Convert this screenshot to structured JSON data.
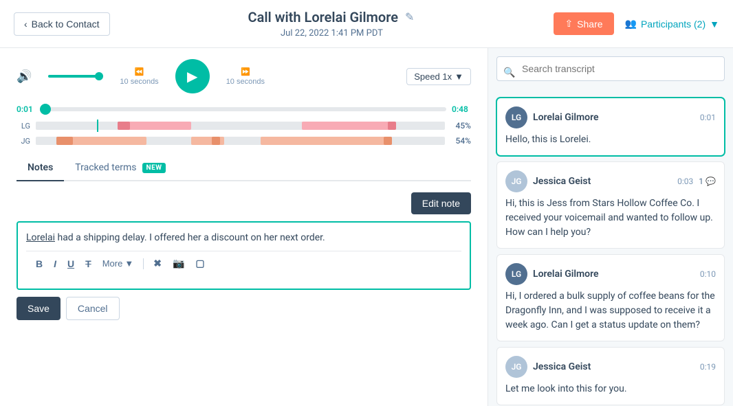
{
  "header": {
    "back_label": "Back to Contact",
    "call_title": "Call with Lorelai Gilmore",
    "call_date": "Jul 22, 2022 1:41 PM PDT",
    "share_label": "Share",
    "participants_label": "Participants (2)"
  },
  "audio": {
    "rewind_label": "10 seconds",
    "forward_label": "10 seconds",
    "speed_label": "Speed 1x",
    "time_start": "0:01",
    "time_end": "0:48"
  },
  "speakers": [
    {
      "id": "LG",
      "pct": "45%"
    },
    {
      "id": "JG",
      "pct": "54%"
    }
  ],
  "tabs": [
    {
      "id": "notes",
      "label": "Notes",
      "active": true
    },
    {
      "id": "tracked",
      "label": "Tracked terms",
      "badge": "NEW"
    }
  ],
  "note": {
    "edit_label": "Edit note",
    "content": "Lorelai had a shipping delay. I offered her a discount on her next order.",
    "toolbar": {
      "bold": "B",
      "italic": "I",
      "underline": "U",
      "strikethrough": "T",
      "more_label": "More"
    },
    "save_label": "Save",
    "cancel_label": "Cancel"
  },
  "transcript": {
    "search_placeholder": "Search transcript",
    "entries": [
      {
        "name": "Lorelai Gilmore",
        "initials": "LG",
        "time": "0:01",
        "text": "Hello, this is Lorelei.",
        "active": true,
        "comment_count": null
      },
      {
        "name": "Jessica Geist",
        "initials": "JG",
        "time": "0:03",
        "text": "Hi, this is Jess from Stars Hollow Coffee Co. I received your voicemail and wanted to follow up. How can I help you?",
        "active": false,
        "comment_count": 1
      },
      {
        "name": "Lorelai Gilmore",
        "initials": "LG",
        "time": "0:10",
        "text": "Hi, I ordered a bulk supply of coffee beans for the Dragonfly Inn, and I was supposed to receive it a week ago. Can I get a status update on them?",
        "active": false,
        "comment_count": null
      },
      {
        "name": "Jessica Geist",
        "initials": "JG",
        "time": "0:19",
        "text": "Let me look into this for you.",
        "active": false,
        "comment_count": null,
        "truncated": true
      }
    ]
  }
}
